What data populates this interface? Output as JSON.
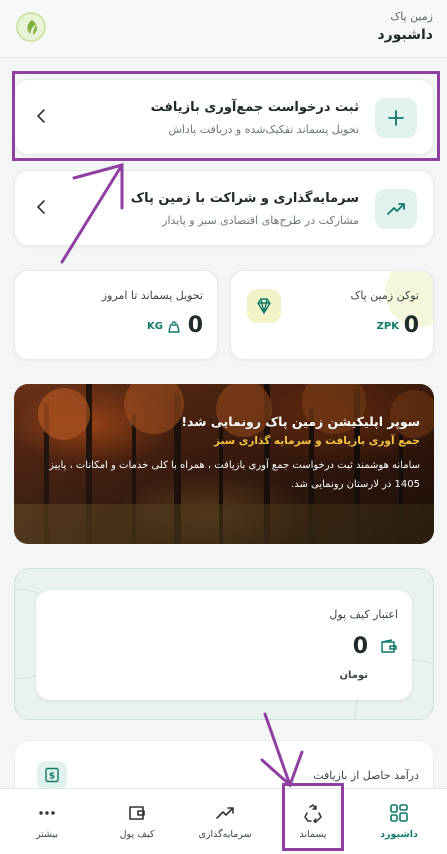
{
  "header": {
    "app_name": "زمین پاک",
    "page_title": "داشبورد",
    "logo_icon": "zamin-pak-logo"
  },
  "actions": [
    {
      "title": "ثبت درخواست جمع‌آوری بازیافت",
      "subtitle": "تحویل پسماند تفکیک‌شده و دریافت پاداش",
      "icon": "plus-icon"
    },
    {
      "title": "سرمایه‌گذاری و شراکت با زمین پاک",
      "subtitle": "مشارکت در طرح‌های اقتصادی سبز و پایدار",
      "icon": "trending-up-icon"
    }
  ],
  "stats": {
    "token": {
      "label": "توکن زمین پاک",
      "value": "0",
      "unit": "ZPK",
      "icon": "gem-icon"
    },
    "delivered": {
      "label": "تحویل پسماند تا امروز",
      "value": "0",
      "unit": "KG",
      "icon": "weight-icon"
    }
  },
  "banner": {
    "title": "سوپر اپلیکیشن زمین پاک رونمایی شد!",
    "subtitle": "جمع آوری بازیافت و سرمایه گذاری سبز",
    "body": "سامانه هوشمند ثبت درخواست جمع آوری بازیافت ، همراه با کلی خدمات و امکانات ، پاییز 1405 در لارستان رونمایی شد."
  },
  "wallet": {
    "label": "اعتبار کیف پول",
    "value": "0",
    "currency": "تومان",
    "icon": "wallet-icon"
  },
  "income": {
    "label": "درآمد حاصل از بازیافت",
    "icon": "dollar-note-icon"
  },
  "nav": [
    {
      "label": "داشبورد",
      "icon": "grid-icon",
      "active": true
    },
    {
      "label": "پسماند",
      "icon": "recycle-icon",
      "active": false
    },
    {
      "label": "سرمایه‌گذاری",
      "icon": "trending-up-icon",
      "active": false
    },
    {
      "label": "کیف پول",
      "icon": "wallet-icon",
      "active": false
    },
    {
      "label": "بیشتر",
      "icon": "more-icon",
      "active": false
    }
  ],
  "colors": {
    "accent": "#0f7a6a",
    "annotation": "#8e3fa0",
    "icon_bg": "#e2f2ee"
  }
}
